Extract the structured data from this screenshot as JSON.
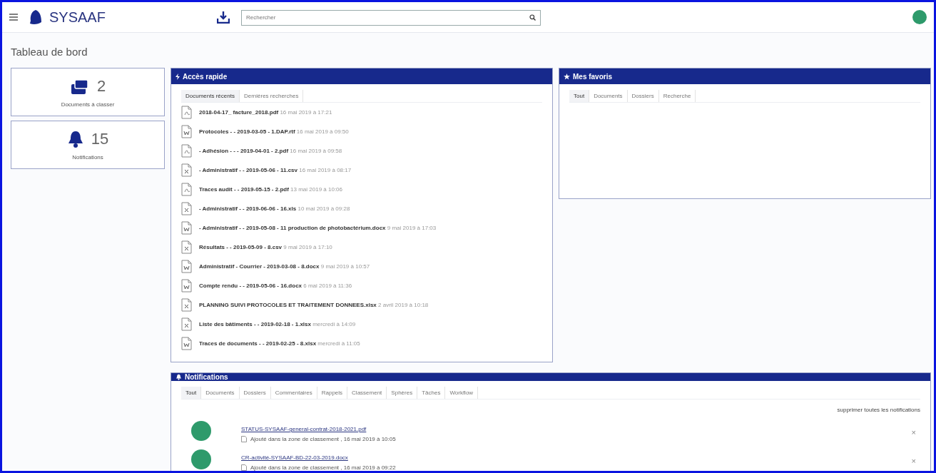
{
  "header": {
    "app_name": "SYSAAF",
    "search": {
      "placeholder": "Rechercher"
    }
  },
  "page_title": "Tableau de bord",
  "stats": [
    {
      "kind": "documents",
      "count": "2",
      "label": "Documents à classer"
    },
    {
      "kind": "notifications",
      "count": "15",
      "label": "Notifications"
    }
  ],
  "quick_access": {
    "title": "Accès rapide",
    "tabs": [
      {
        "label": "Documents récents",
        "selected": true
      },
      {
        "label": "Dernières recherches",
        "selected": false
      }
    ],
    "documents": [
      {
        "kind": "pdf",
        "name": "2018-04-17_ facture_2018.pdf",
        "date": "16 mai 2019 à 17:21"
      },
      {
        "kind": "word",
        "name": "Protocoles - - 2019-03-05 - 1.DAP.rtf",
        "date": "16 mai 2019 à 09:50"
      },
      {
        "kind": "pdf",
        "name": "- Adhésion - - - 2019-04-01 - 2.pdf",
        "date": "16 mai 2019 à 09:58"
      },
      {
        "kind": "excel",
        "name": "- Administratif - - 2019-05-06 - 11.csv",
        "date": "16 mai 2019 à 08:17"
      },
      {
        "kind": "pdf",
        "name": "Traces audit - - 2019-05-15 - 2.pdf",
        "date": "13 mai 2019 à 10:06"
      },
      {
        "kind": "excel",
        "name": "- Administratif - - 2019-06-06 - 16.xls",
        "date": "10 mai 2019 à 09:28"
      },
      {
        "kind": "word",
        "name": "- Administratif - - 2019-05-08 - 11 production de photobactérium.docx",
        "date": "9 mai 2019 à 17:03"
      },
      {
        "kind": "excel",
        "name": "Résultats - - 2019-05-09 - 8.csv",
        "date": "9 mai 2019 à 17:10"
      },
      {
        "kind": "word",
        "name": "Administratif - Courrier - 2019-03-08 - 8.docx",
        "date": "9 mai 2019 à 10:57"
      },
      {
        "kind": "word",
        "name": "Compte rendu - - 2019-05-06 - 16.docx",
        "date": "6 mai 2019 à 11:36"
      },
      {
        "kind": "excel",
        "name": "PLANNING SUIVI PROTOCOLES ET TRAITEMENT DONNEES.xlsx",
        "date": "2 avril 2019 à 10:18"
      },
      {
        "kind": "excel",
        "name": "Liste des bâtiments - - 2019-02-18 - 1.xlsx",
        "date": "mercredi à 14:09"
      },
      {
        "kind": "word",
        "name": "Traces de documents - - 2019-02-25 - 8.xlsx",
        "date": "mercredi à 11:05"
      }
    ]
  },
  "favorites": {
    "title": "Mes favoris",
    "tabs": [
      {
        "label": "Tout",
        "selected": true
      },
      {
        "label": "Documents",
        "selected": false
      },
      {
        "label": "Dossiers",
        "selected": false
      },
      {
        "label": "Recherche",
        "selected": false
      }
    ]
  },
  "notifications": {
    "title": "Notifications",
    "tabs": [
      {
        "label": "Tout",
        "selected": true
      },
      {
        "label": "Documents",
        "selected": false
      },
      {
        "label": "Dossiers",
        "selected": false
      },
      {
        "label": "Commentaires",
        "selected": false
      },
      {
        "label": "Rappels",
        "selected": false
      },
      {
        "label": "Classement",
        "selected": false
      },
      {
        "label": "Sphères",
        "selected": false
      },
      {
        "label": "Tâches",
        "selected": false
      },
      {
        "label": "Workflow",
        "selected": false
      }
    ],
    "clear_all": "supprimer toutes les notifications",
    "items": [
      {
        "file": "STATUS-SYSAAF-general-contrat-2018-2021.pdf",
        "detail": "Ajouté dans la zone de classement , 16 mai 2019 à 10:05",
        "close": "×"
      },
      {
        "file": "CR-activité-SYSAAF-BD-22-03-2019.docx",
        "detail": "Ajouté dans la zone de classement , 16 mai 2019 à 09:22",
        "close": "×"
      }
    ]
  }
}
